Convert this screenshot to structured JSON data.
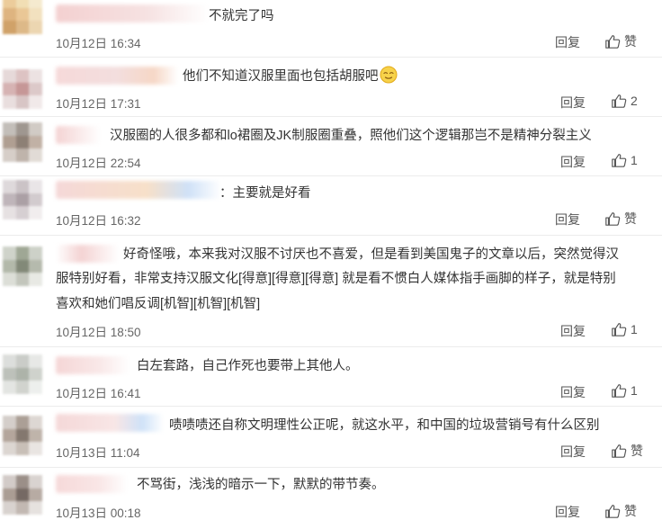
{
  "colors": {
    "text": "#333333",
    "meta": "#666666",
    "divider": "#ececec"
  },
  "comments": [
    {
      "text": "不就完了吗",
      "time": "10月12日 16:34",
      "reply_label": "回复",
      "like_label": "赞"
    },
    {
      "text": "他们不知道汉服里面也包括胡服吧",
      "emoji": "smirk-emoji",
      "time": "10月12日 17:31",
      "reply_label": "回复",
      "like_label": "2"
    },
    {
      "text": "汉服圈的人很多都和lo裙圈及JK制服圈重叠，照他们这个逻辑那岂不是精神分裂主义",
      "time": "10月12日 22:54",
      "reply_label": "回复",
      "like_label": "1"
    },
    {
      "text": "：主要就是好看",
      "time": "10月12日 16:32",
      "reply_label": "回复",
      "like_label": "赞"
    },
    {
      "lines": [
        "好奇怪哦，本来我对汉服不讨厌也不喜爱，但是看到美国鬼子的文章以后，突然觉得汉",
        "服特别好看，非常支持汉服文化[得意][得意][得意] 就是看不惯白人媒体指手画脚的样子，就是特别",
        "喜欢和她们唱反调[机智][机智][机智]"
      ],
      "time": "10月12日 18:50",
      "reply_label": "回复",
      "like_label": "1"
    },
    {
      "text": "白左套路，自己作死也要带上其他人。",
      "time": "10月12日 16:41",
      "reply_label": "回复",
      "like_label": "1"
    },
    {
      "text": "啧啧啧还自称文明理性公正呢，就这水平，和中国的垃圾营销号有什么区别",
      "time": "10月13日 11:04",
      "reply_label": "回复",
      "like_label": "赞"
    },
    {
      "text": "不骂街，浅浅的暗示一下，默默的带节奏。",
      "time": "10月13日 00:18",
      "reply_label": "回复",
      "like_label": "赞"
    }
  ]
}
